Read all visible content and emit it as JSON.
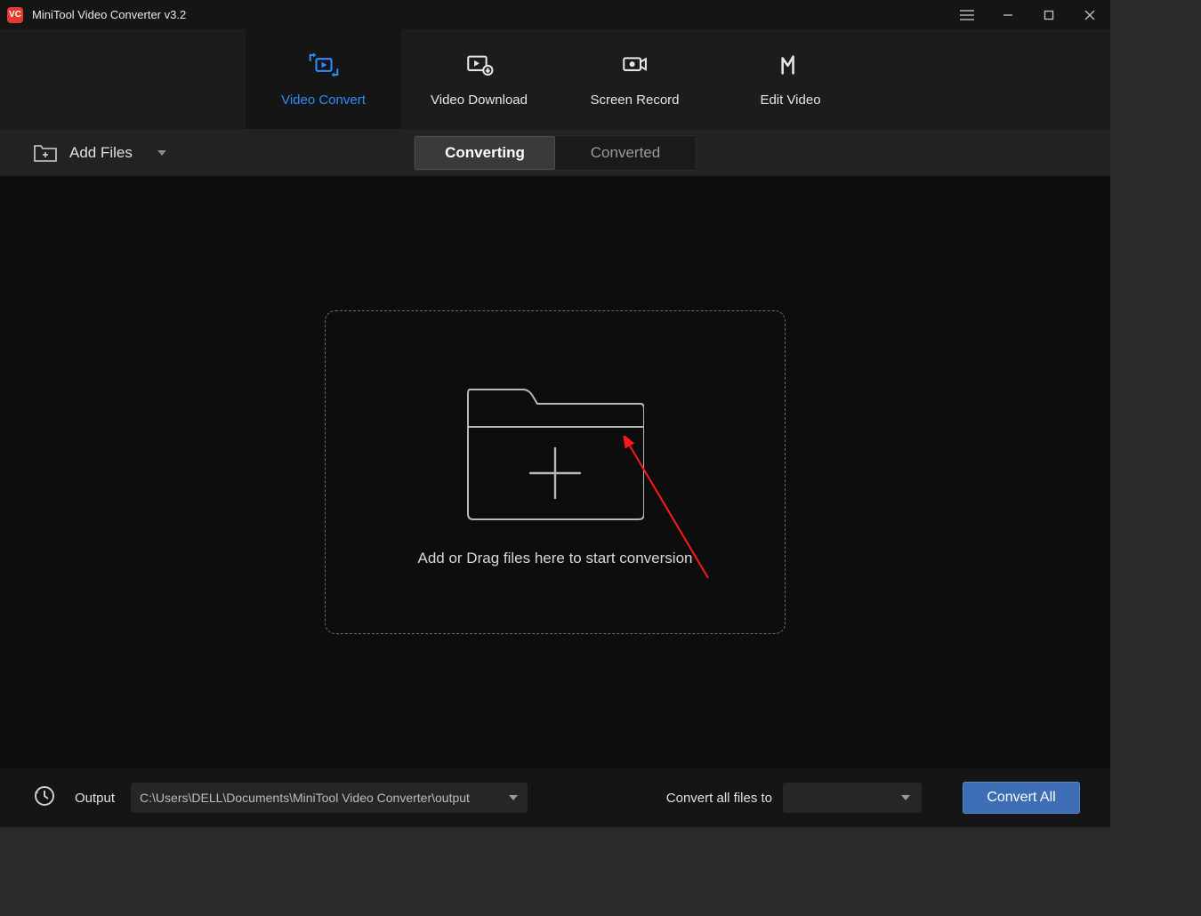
{
  "title": "MiniTool Video Converter v3.2",
  "nav": {
    "items": [
      {
        "label": "Video Convert"
      },
      {
        "label": "Video Download"
      },
      {
        "label": "Screen Record"
      },
      {
        "label": "Edit Video"
      }
    ]
  },
  "toolbar": {
    "add_files_label": "Add Files",
    "seg_converting": "Converting",
    "seg_converted": "Converted"
  },
  "dropzone": {
    "text": "Add or Drag files here to start conversion"
  },
  "bottom": {
    "output_label": "Output",
    "output_path": "C:\\Users\\DELL\\Documents\\MiniTool Video Converter\\output",
    "convert_all_to_label": "Convert all files to",
    "convert_all_btn": "Convert All"
  },
  "colors": {
    "accent": "#2d8cff",
    "brand_red": "#e23b2e",
    "primary_btn": "#3d6db5"
  }
}
